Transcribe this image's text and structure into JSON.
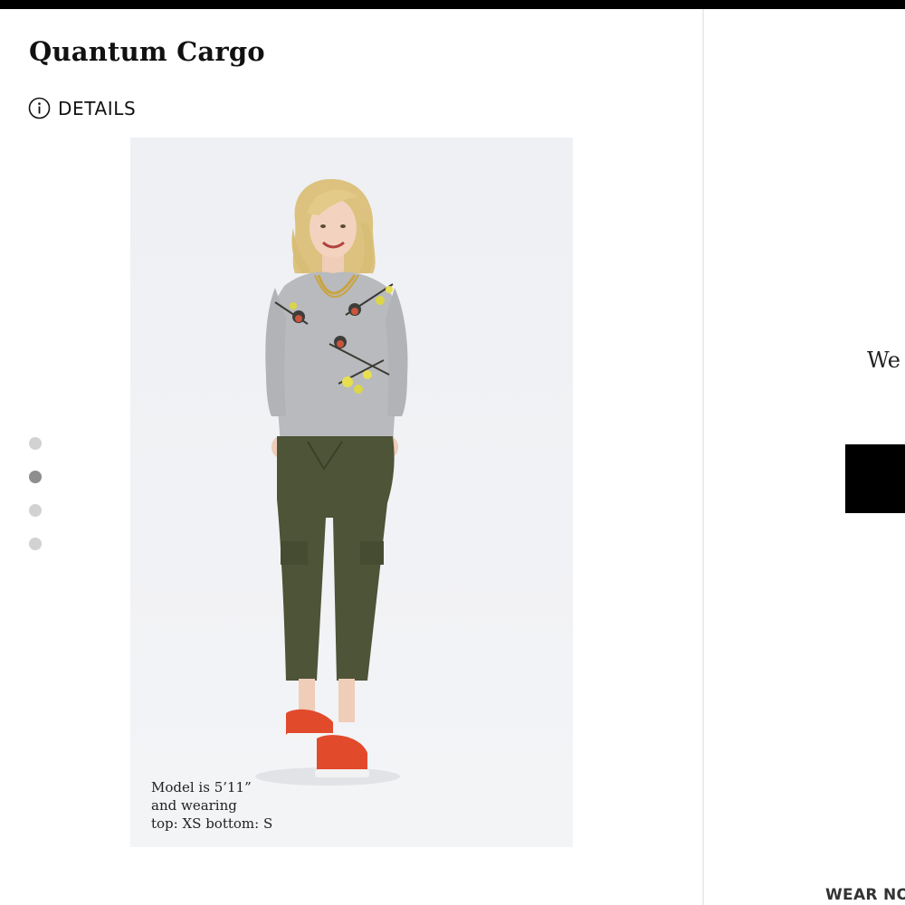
{
  "product": {
    "title": "Quantum Cargo",
    "details_label": "DETAILS",
    "details_icon": "info-circle-icon"
  },
  "gallery": {
    "image_alt": "Model wearing gray embroidered bird sweater, olive cargo joggers and red sneakers",
    "dot_count": 4,
    "active_index": 1,
    "caption_lines": [
      "Model is 5’11”",
      "and wearing",
      "top: XS bottom: S"
    ]
  },
  "right_panel": {
    "partial_text": "We",
    "bottom_label": "WEAR NO"
  },
  "colors": {
    "topbar": "#000000",
    "dot_inactive": "#d2d2d2",
    "dot_active": "#8e8e8e",
    "pants": "#4d5437",
    "sweater": "#b5b6b8",
    "sneakers": "#e24a2c"
  }
}
